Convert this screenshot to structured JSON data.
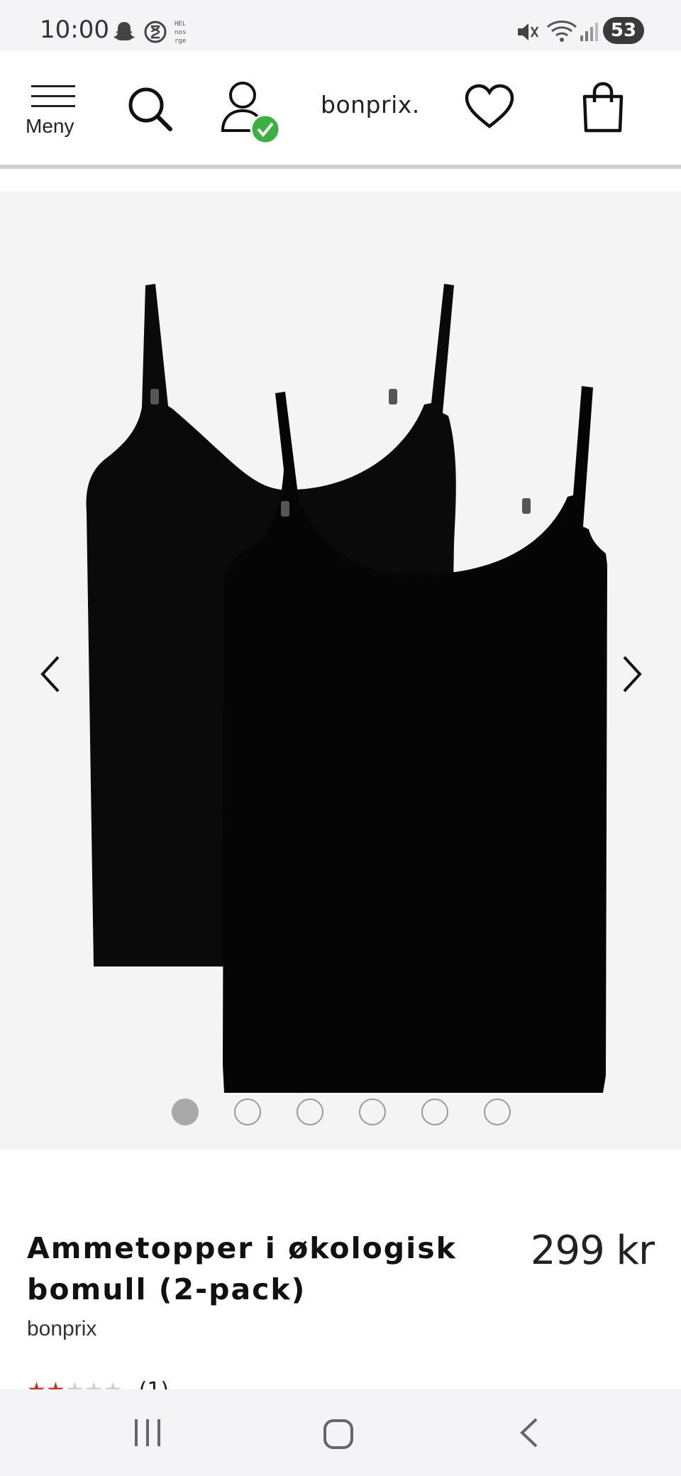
{
  "status_bar": {
    "time": "10:00",
    "battery": "53",
    "icons": [
      "snapchat-icon",
      "hourglass-icon",
      "heart-nrk-icon",
      "mute-icon",
      "wifi-icon",
      "signal-icon"
    ]
  },
  "header": {
    "menu_label": "Meny",
    "logo": "bonprix.",
    "icons": [
      "menu-icon",
      "search-icon",
      "account-icon",
      "logged-in-check-icon",
      "wishlist-heart-icon",
      "shopping-bag-icon"
    ]
  },
  "gallery": {
    "image_count": 6,
    "active_index": 0,
    "prev_icon": "chevron-left-icon",
    "next_icon": "chevron-right-icon"
  },
  "product": {
    "title": "Ammetopper i økologisk bomull (2-pack)",
    "brand": "bonprix",
    "price": "299 kr",
    "rating": 2,
    "rating_max": 5,
    "review_count": "(1)"
  },
  "nav_bar": {
    "icons": [
      "recent-apps-icon",
      "home-icon",
      "back-icon"
    ]
  },
  "colors": {
    "gallery_bg": "#f4f4f4",
    "check_green": "#3cb043",
    "star_red": "#c0392b"
  }
}
